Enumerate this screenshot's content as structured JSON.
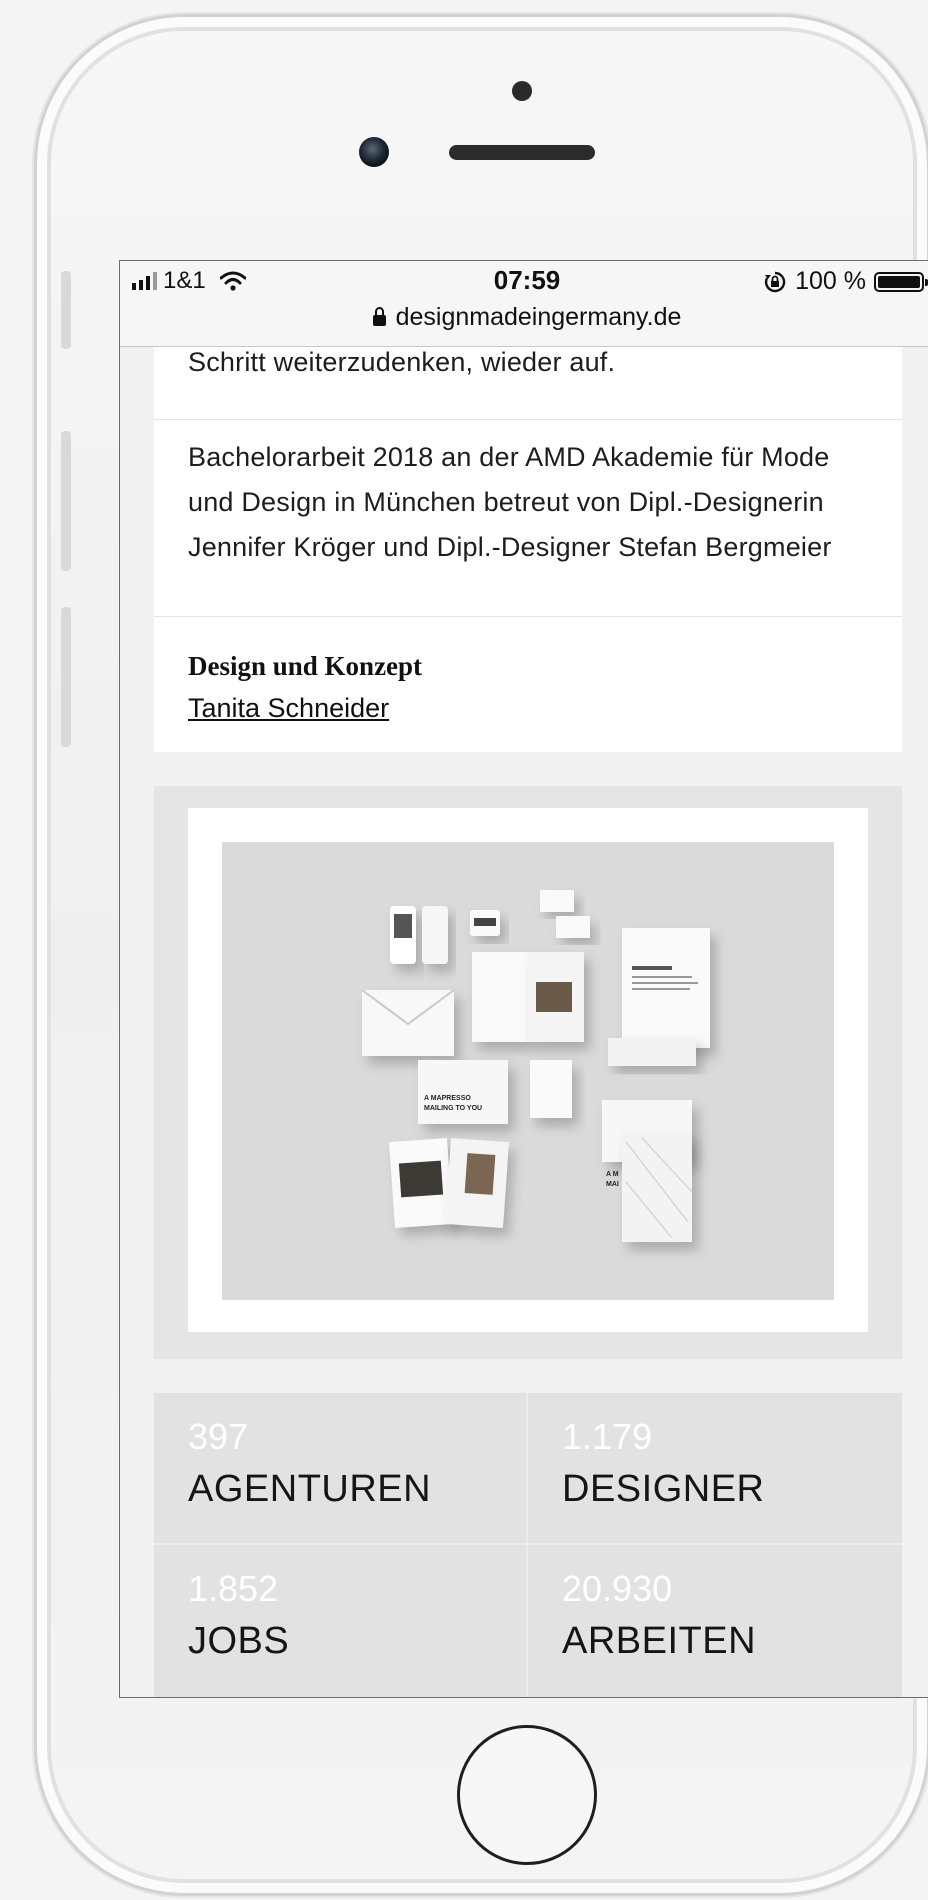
{
  "statusbar": {
    "carrier": "1&1",
    "time": "07:59",
    "battery_text": "100 %",
    "url": "designmadeingermany.de"
  },
  "article": {
    "intro_tail": "Leitidee der Marke, eigene Wege zu gehen und einen Schritt weiterzudenken, wieder auf.",
    "thesis": "Bachelorarbeit 2018 an der AMD Akademie für Mode und Design in München betreut von Dipl.-Designerin Jennifer Kröger und Dipl.-Designer Stefan Bergmeier",
    "credit_label": "Design und Konzept",
    "credit_name": "Tanita Schneider"
  },
  "gallery": {
    "mockup_texts": [
      "A MAPRESSO MAILING TO YOU",
      "A M MAI"
    ]
  },
  "stats": [
    {
      "number": "397",
      "label": "AGENTUREN"
    },
    {
      "number": "1.179",
      "label": "DESIGNER"
    },
    {
      "number": "1.852",
      "label": "JOBS"
    },
    {
      "number": "20.930",
      "label": "ARBEITEN"
    }
  ],
  "colors": {
    "screen_bg": "#f1f1f1",
    "card_bg": "#ffffff",
    "stats_bg": "#e2e2e2",
    "text": "#1d1d1d"
  }
}
